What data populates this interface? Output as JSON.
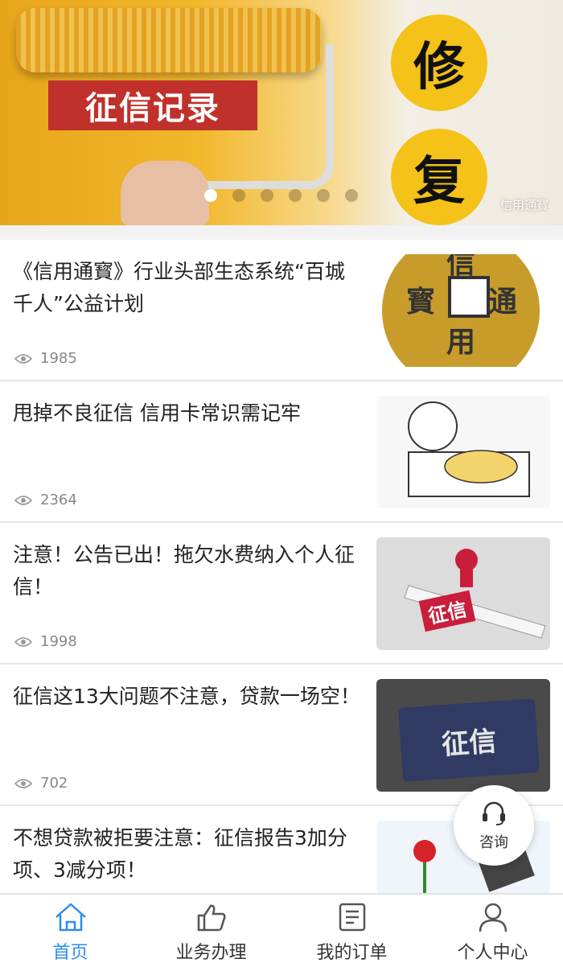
{
  "banner": {
    "tag_text": "征信记录",
    "circle_chars": [
      "修",
      "复"
    ],
    "watermark": "信用通寳",
    "dots_total": 6,
    "dots_active_index": 0
  },
  "articles": [
    {
      "title": "《信用通寳》行业头部生态系统“百城千人”公益计划",
      "views": "1985",
      "thumb": "coin-icon"
    },
    {
      "title": "甩掉不良征信 信用卡常识需记牢",
      "views": "2364",
      "thumb": "meme-illustration"
    },
    {
      "title": "注意！公告已出！拖欠水费纳入个人征信！",
      "views": "1998",
      "thumb": "stamp-ruler-illustration"
    },
    {
      "title": "征信这13大问题不注意，贷款一场空！",
      "views": "702",
      "thumb": "credit-card-suit-illustration"
    },
    {
      "title": "不想贷款被拒要注意：征信报告3加分项、3减分项！",
      "views": "",
      "thumb": "flower-illustration"
    }
  ],
  "coin_chars": {
    "top": "信",
    "left": "寳",
    "right": "通",
    "bottom": "用"
  },
  "ruler_tag": "征信",
  "card_text": "征信",
  "consult": {
    "label": "咨询"
  },
  "tabs": [
    {
      "label": "首页",
      "icon": "home-icon",
      "active": true
    },
    {
      "label": "业务办理",
      "icon": "thumbs-up-icon",
      "active": false
    },
    {
      "label": "我的订单",
      "icon": "order-list-icon",
      "active": false
    },
    {
      "label": "个人中心",
      "icon": "person-icon",
      "active": false
    }
  ],
  "colors": {
    "accent": "#2c8df0",
    "banner_red": "#c0312b",
    "circle_yellow": "#f4c218"
  }
}
